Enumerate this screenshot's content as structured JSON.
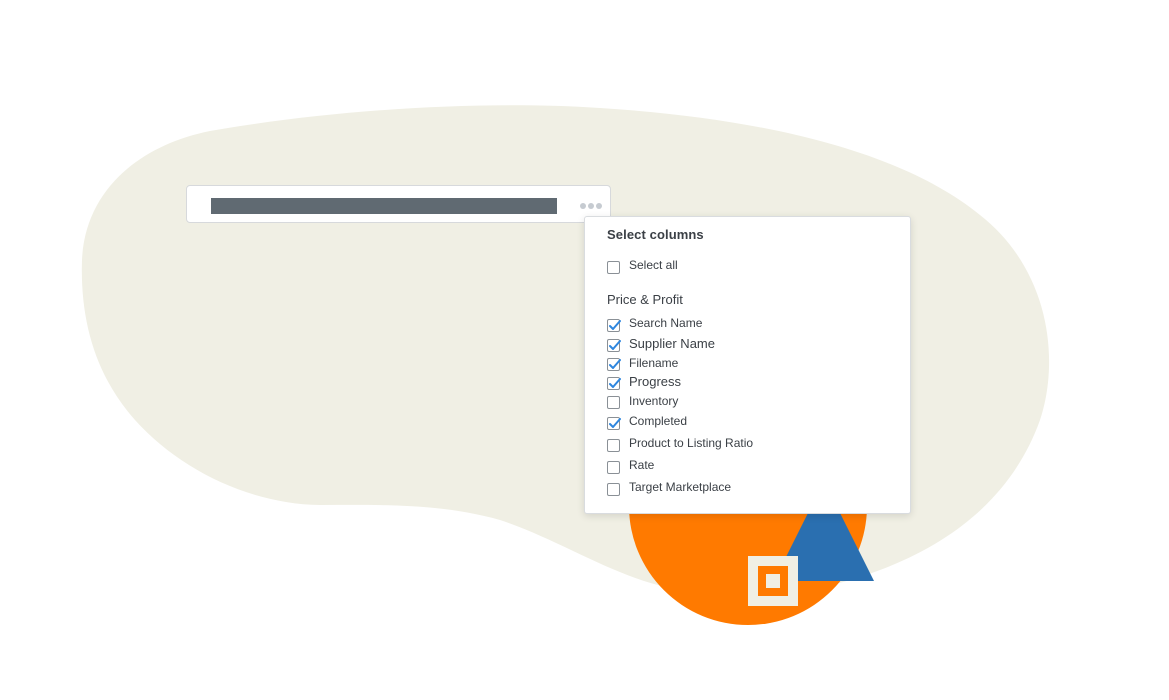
{
  "colors": {
    "blob": "#f0efe4",
    "orange": "#ff7a00",
    "blue": "#2a6fb0",
    "check": "#2e86de"
  },
  "search_bar": {
    "more_icon": "more-horizontal-icon"
  },
  "dropdown": {
    "title": "Select columns",
    "select_all": {
      "label": "Select all",
      "checked": false
    },
    "section_label": "Price & Profit",
    "columns": [
      {
        "label": "Search Name",
        "checked": true
      },
      {
        "label": "Supplier Name",
        "checked": true
      },
      {
        "label": "Filename",
        "checked": true
      },
      {
        "label": "Progress",
        "checked": true
      },
      {
        "label": "Inventory",
        "checked": false
      },
      {
        "label": "Completed",
        "checked": true
      },
      {
        "label": "Product to Listing Ratio",
        "checked": false
      },
      {
        "label": "Rate",
        "checked": false
      },
      {
        "label": "Target Marketplace",
        "checked": false
      }
    ]
  }
}
